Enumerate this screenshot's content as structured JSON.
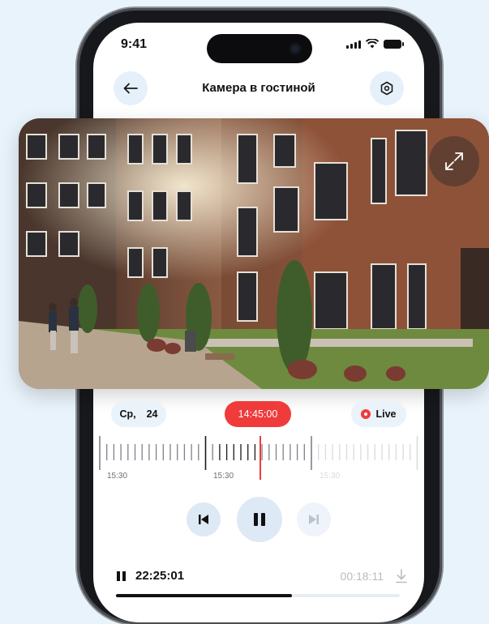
{
  "status_bar": {
    "time": "9:41"
  },
  "header": {
    "title": "Камера в гостиной"
  },
  "player": {
    "date_day": "Ср,",
    "date_num": "24",
    "current_time": "14:45:00",
    "live_label": "Live",
    "timeline_labels": [
      "15:30",
      "15:30",
      "15:30"
    ]
  },
  "recording": {
    "time": "22:25:01",
    "duration": "00:18:11",
    "progress": 0.62
  },
  "colors": {
    "accent": "#f03b3b",
    "soft_blue": "#e6f0fa",
    "background": "#e9f3fb"
  },
  "icons": [
    "back-arrow-icon",
    "settings-hex-icon",
    "expand-icon",
    "live-dot-icon",
    "skip-previous-icon",
    "pause-icon",
    "skip-next-icon",
    "download-icon"
  ]
}
